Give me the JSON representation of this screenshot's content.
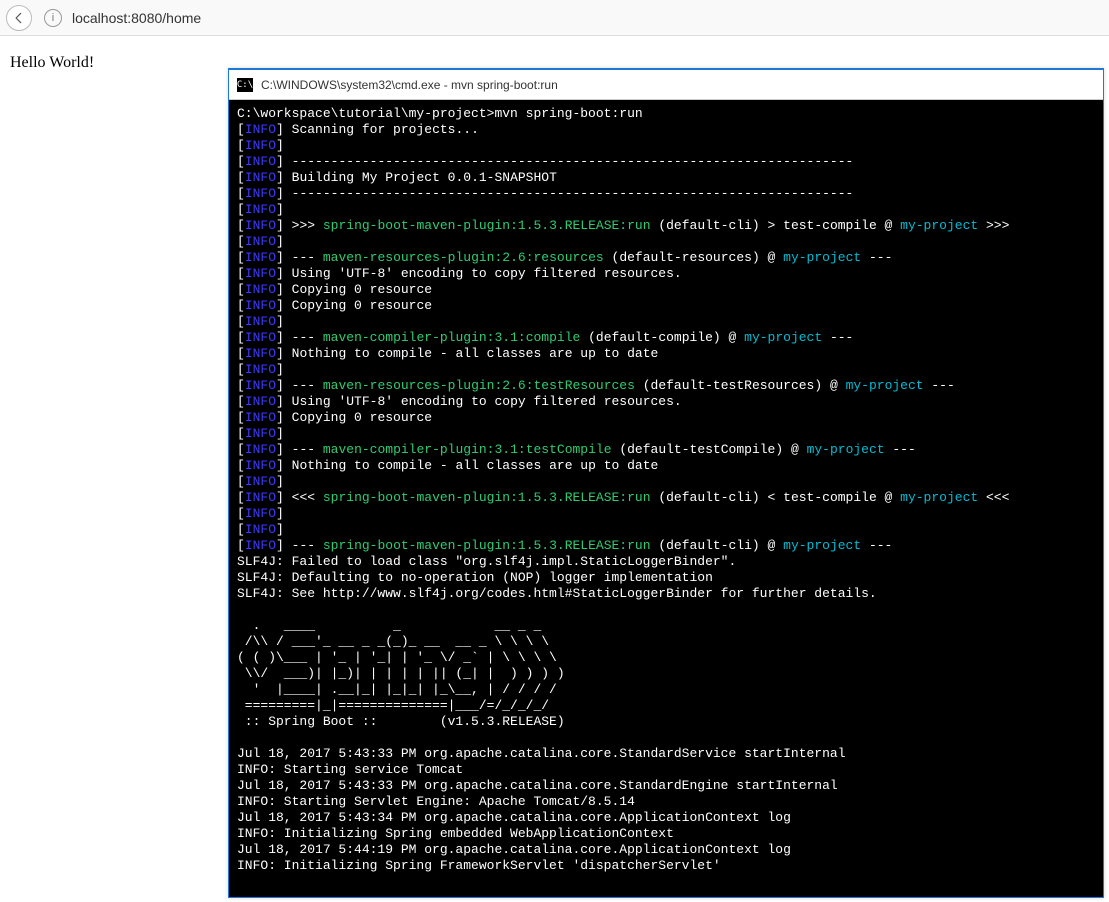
{
  "browser": {
    "url": "localhost:8080/home"
  },
  "page": {
    "body_text": "Hello World!"
  },
  "cmd": {
    "title": "C:\\WINDOWS\\system32\\cmd.exe - mvn  spring-boot:run",
    "prompt": "C:\\workspace\\tutorial\\my-project>mvn spring-boot:run",
    "label_info": "INFO",
    "scan": " Scanning for projects...",
    "dashes": " ------------------------------------------------------------------------",
    "building": " Building My Project 0.0.1-SNAPSHOT",
    "ln_run_head": " >>> ",
    "plugin_run": "spring-boot-maven-plugin:1.5.3.RELEASE:run",
    "ln_run_mid1": " (default-cli) > test-compile @ ",
    "my_project": "my-project",
    "ln_run_tail1": " >>>",
    "dash3": " --- ",
    "plugin_res": "maven-resources-plugin:2.6:resources",
    "res_mid": " (default-resources) @ ",
    "dash_end": " ---",
    "utf": " Using 'UTF-8' encoding to copy filtered resources.",
    "copy0": " Copying 0 resource",
    "plugin_comp": "maven-compiler-plugin:3.1:compile",
    "comp_mid": " (default-compile) @ ",
    "nothing": " Nothing to compile - all classes are up to date",
    "plugin_testres": "maven-resources-plugin:2.6:testResources",
    "testres_mid": " (default-testResources) @ ",
    "plugin_testcomp": "maven-compiler-plugin:3.1:testCompile",
    "testcomp_mid": " (default-testCompile) @ ",
    "ln_run_back_head": " <<< ",
    "ln_run_back_mid": " (default-cli) < test-compile @ ",
    "ln_run_back_tail": " <<<",
    "run_final_mid": " (default-cli) @ ",
    "slf4j_1": "SLF4J: Failed to load class \"org.slf4j.impl.StaticLoggerBinder\".",
    "slf4j_2": "SLF4J: Defaulting to no-operation (NOP) logger implementation",
    "slf4j_3": "SLF4J: See http://www.slf4j.org/codes.html#StaticLoggerBinder for further details.",
    "banner": "  .   ____          _            __ _ _\n /\\\\ / ___'_ __ _ _(_)_ __  __ _ \\ \\ \\ \\\n( ( )\\___ | '_ | '_| | '_ \\/ _` | \\ \\ \\ \\\n \\\\/  ___)| |_)| | | | | || (_| |  ) ) ) )\n  '  |____| .__|_| |_|_| |_\\__, | / / / /\n =========|_|==============|___/=/_/_/_/",
    "boot_label": " :: Spring Boot ::        (v1.5.3.RELEASE)",
    "tom1": "Jul 18, 2017 5:43:33 PM org.apache.catalina.core.StandardService startInternal",
    "tom2": "INFO: Starting service Tomcat",
    "tom3": "Jul 18, 2017 5:43:33 PM org.apache.catalina.core.StandardEngine startInternal",
    "tom4": "INFO: Starting Servlet Engine: Apache Tomcat/8.5.14",
    "tom5": "Jul 18, 2017 5:43:34 PM org.apache.catalina.core.ApplicationContext log",
    "tom6": "INFO: Initializing Spring embedded WebApplicationContext",
    "tom7": "Jul 18, 2017 5:44:19 PM org.apache.catalina.core.ApplicationContext log",
    "tom8": "INFO: Initializing Spring FrameworkServlet 'dispatcherServlet'"
  }
}
